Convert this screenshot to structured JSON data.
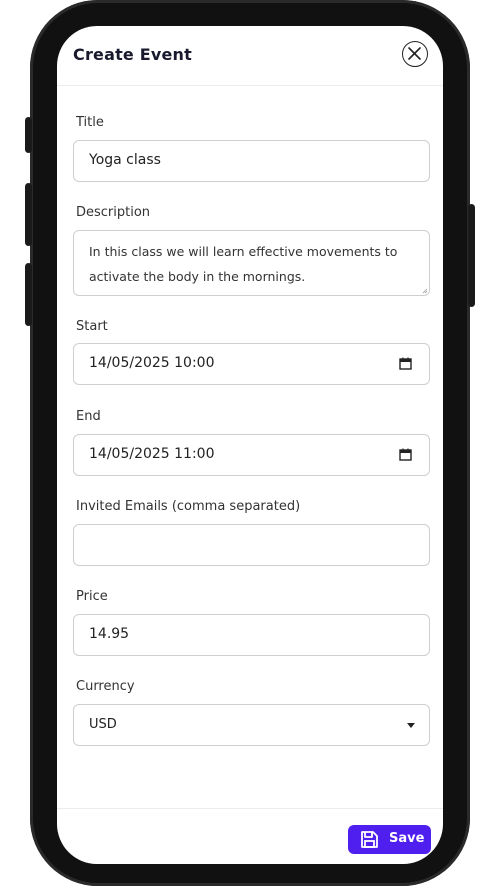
{
  "modal": {
    "title": "Create Event",
    "close_icon": "close-icon"
  },
  "fields": {
    "title": {
      "label": "Title",
      "value": "Yoga class"
    },
    "description": {
      "label": "Description",
      "value": "In this class we will learn effective movements to activate the body in the mornings."
    },
    "start": {
      "label": "Start",
      "value": "14/05/2025 10:00",
      "icon": "calendar-icon"
    },
    "end": {
      "label": "End",
      "value": "14/05/2025 11:00",
      "icon": "calendar-icon"
    },
    "invited_emails": {
      "label": "Invited Emails (comma separated)",
      "value": ""
    },
    "price": {
      "label": "Price",
      "value": "14.95"
    },
    "currency": {
      "label": "Currency",
      "value": "USD",
      "icon": "caret-down-icon"
    }
  },
  "footer": {
    "save_label": "Save",
    "save_icon": "floppy-disk-icon"
  },
  "colors": {
    "accent": "#4f1ff0",
    "phone_frame": "#111111"
  }
}
